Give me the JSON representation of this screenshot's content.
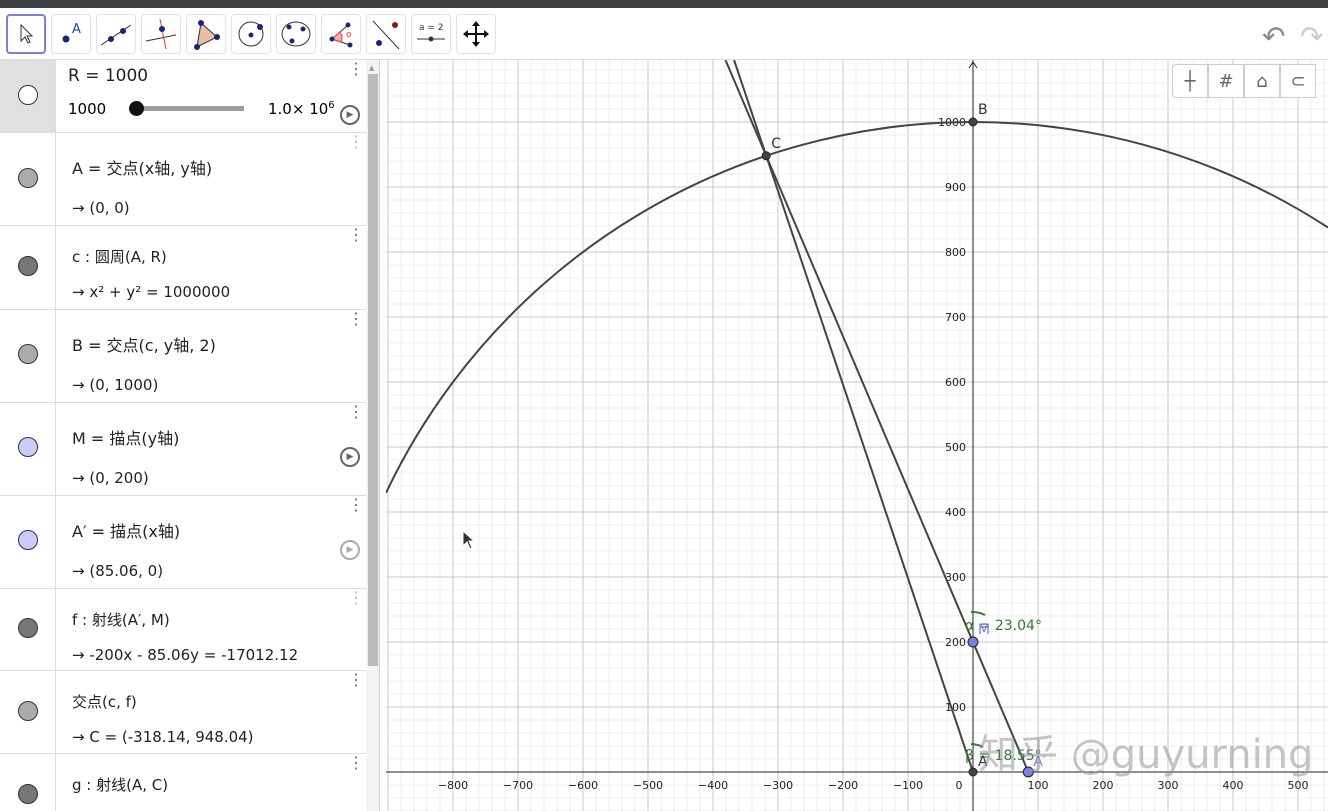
{
  "toolbar": {
    "tools": [
      "move",
      "point",
      "line",
      "perpendicular",
      "polygon",
      "circle-center-point",
      "conic-five-points",
      "angle",
      "reflect",
      "slider",
      "move-graphics"
    ],
    "slider_icon_label": "a = 2",
    "point_icon_label": "A"
  },
  "algebra": {
    "rows": [
      {
        "def": "R = 1000",
        "slider_min": "1000",
        "slider_max": "1.0× 10",
        "slider_max_exp": "6",
        "slider_fraction": 0.0
      },
      {
        "def": "A = 交点(x轴, y轴)",
        "val": "→  (0, 0)"
      },
      {
        "def": "c : 圆周(A, R)",
        "val": "→  x² + y² = 1000000"
      },
      {
        "def": "B = 交点(c, y轴, 2)",
        "val": "→  (0, 1000)"
      },
      {
        "def": "M = 描点(y轴)",
        "val": "→  (0, 200)"
      },
      {
        "def": "A′ = 描点(x轴)",
        "val": "→  (85.06, 0)"
      },
      {
        "def": "f : 射线(A′, M)",
        "val": "→  -200x - 85.06y = -17012.12"
      },
      {
        "def": "交点(c, f)",
        "val": "→  C = (-318.14, 948.04)"
      },
      {
        "def": "g : 射线(A, C)",
        "val": ""
      }
    ]
  },
  "graph": {
    "x_ticks": [
      "−800",
      "−700",
      "−600",
      "−500",
      "−400",
      "−300",
      "−200",
      "−100",
      "0",
      "100",
      "200",
      "300",
      "400",
      "500"
    ],
    "y_ticks": [
      "100",
      "200",
      "300",
      "400",
      "500",
      "600",
      "700",
      "800",
      "900",
      "1000"
    ],
    "points": {
      "A": {
        "label": "A",
        "x": 0,
        "y": 0
      },
      "B": {
        "label": "B",
        "x": 0,
        "y": 1000
      },
      "C": {
        "label": "C",
        "x": -318.14,
        "y": 948.04
      },
      "M": {
        "label": "M",
        "x": 0,
        "y": 200
      },
      "A2": {
        "label": "A′",
        "x": 85.06,
        "y": 0
      }
    },
    "radius": 1000,
    "alpha_label": "α = 23.04°",
    "beta_label": "β = 18.55°",
    "colors": {
      "line": "#444444",
      "free_point": "#7b7fe8",
      "angle": "#2e7d32"
    },
    "watermark": "知乎 @guyurning"
  }
}
